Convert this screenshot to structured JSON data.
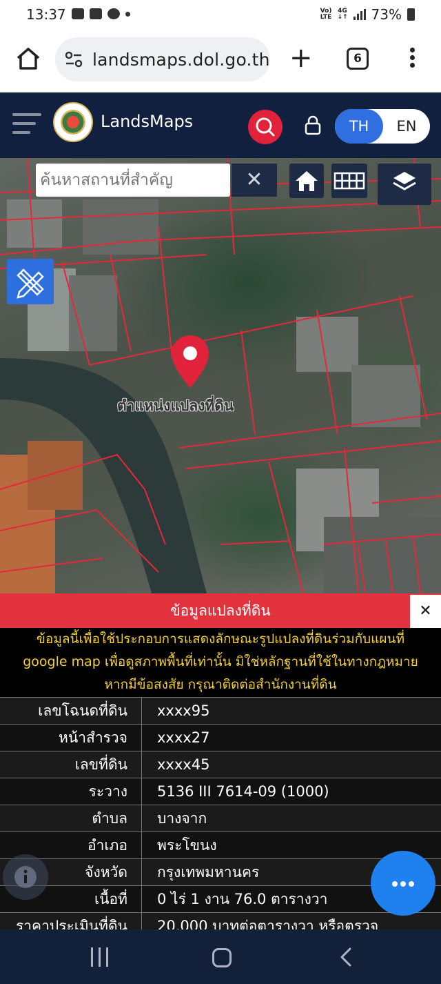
{
  "status_bar": {
    "time": "13:37",
    "network_line1": "Vo)",
    "network_line2": "LTE",
    "network_type": "4G",
    "battery": "73%"
  },
  "browser": {
    "url": "landsmaps.dol.go.th",
    "tab_count": "6"
  },
  "app": {
    "title": "LandsMaps",
    "lang_th": "TH",
    "lang_en": "EN",
    "accent_color": "#e0223a",
    "header_color": "#11203e"
  },
  "map": {
    "search_placeholder": "ค้นหาสถานที่สำคัญ",
    "clear_symbol": "✕",
    "parcel_label": "ตำแหน่งแปลงที่ดิน"
  },
  "info": {
    "title": "ข้อมูลแปลงที่ดิน",
    "close_symbol": "✕",
    "disclaimer": [
      "ข้อมูลนี้เพื่อใช้ประกอบการแสดงลักษณะรูปแปลงที่ดินร่วมกับแผนที่",
      "google map เพื่อดูสภาพพื้นที่เท่านั้น มิใช่หลักฐานที่ใช้ในทางกฎหมาย",
      "หากมีข้อสงสัย กรุณาติดต่อสำนักงานที่ดิน"
    ],
    "rows": [
      {
        "label": "เลขโฉนดที่ดิน",
        "value": "xxxx95"
      },
      {
        "label": "หน้าสำรวจ",
        "value": "xxxx27"
      },
      {
        "label": "เลขที่ดิน",
        "value": "xxxx45"
      },
      {
        "label": "ระวาง",
        "value": "5136 III 7614-09 (1000)"
      },
      {
        "label": "ตำบล",
        "value": "บางจาก"
      },
      {
        "label": "อำเภอ",
        "value": "พระโขนง"
      },
      {
        "label": "จังหวัด",
        "value": "กรุงเทพมหานคร"
      },
      {
        "label": "เนื้อที่",
        "value": "0 ไร่ 1 งาน 76.0 ตารางวา"
      },
      {
        "label": "ราคาประเมินที่ดิน",
        "value": "20,000 บาทต่อตารางวา หรือตรวจ"
      }
    ]
  }
}
